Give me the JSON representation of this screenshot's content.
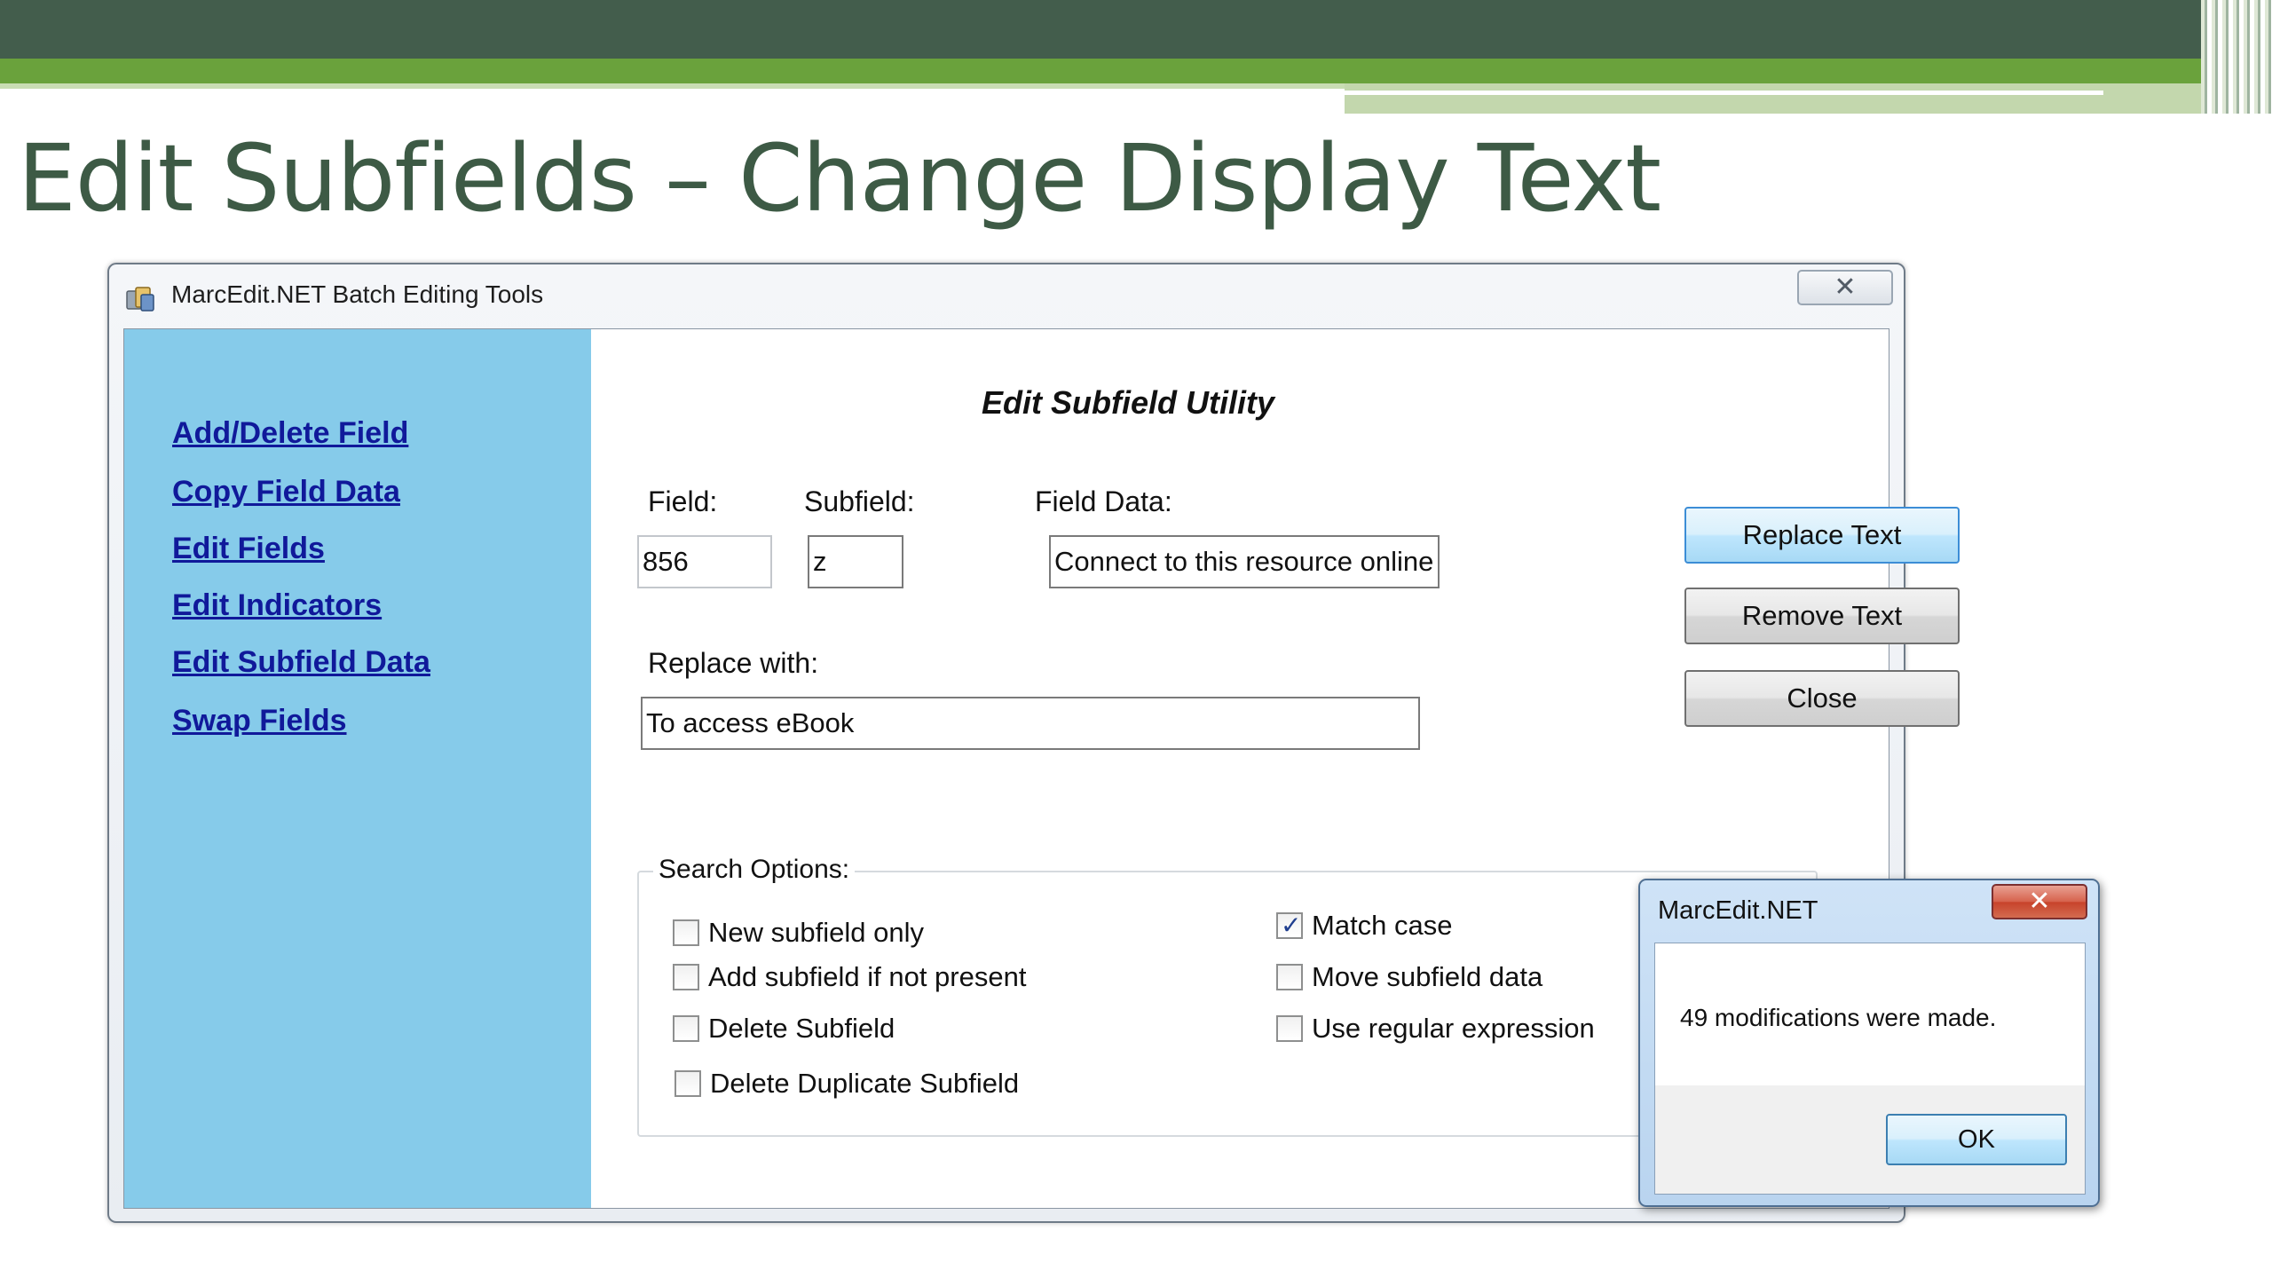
{
  "slide": {
    "title": "Edit Subfields – Change Display Text"
  },
  "window": {
    "title": "MarcEdit.NET Batch Editing Tools",
    "close_glyph": "✕",
    "icon": "app-icon"
  },
  "sidebar": {
    "items": [
      {
        "label": "Add/Delete Field"
      },
      {
        "label": "Copy Field Data"
      },
      {
        "label": "Edit Fields"
      },
      {
        "label": "Edit Indicators"
      },
      {
        "label": "Edit Subfield Data"
      },
      {
        "label": "Swap Fields"
      }
    ]
  },
  "panel": {
    "title": "Edit Subfield Utility",
    "field_label": "Field:",
    "field_value": "856",
    "subfield_label": "Subfield:",
    "subfield_value": "z",
    "field_data_label": "Field Data:",
    "field_data_value": "Connect to this resource online",
    "replace_label": "Replace with:",
    "replace_value": "To access eBook",
    "buttons": {
      "replace": "Replace Text",
      "remove": "Remove Text",
      "close": "Close"
    }
  },
  "search_options": {
    "legend": "Search Options:",
    "options": [
      {
        "label": "New subfield only",
        "checked": false
      },
      {
        "label": "Add subfield if not present",
        "checked": false
      },
      {
        "label": "Delete Subfield",
        "checked": false
      },
      {
        "label": "Delete Duplicate Subfield",
        "checked": false
      },
      {
        "label": "Match case",
        "checked": true
      },
      {
        "label": "Move subfield data",
        "checked": false
      },
      {
        "label": "Use regular expression",
        "checked": false
      }
    ]
  },
  "dialog": {
    "title": "MarcEdit.NET",
    "message": "49 modifications were made.",
    "ok_label": "OK",
    "close_glyph": "✕"
  }
}
